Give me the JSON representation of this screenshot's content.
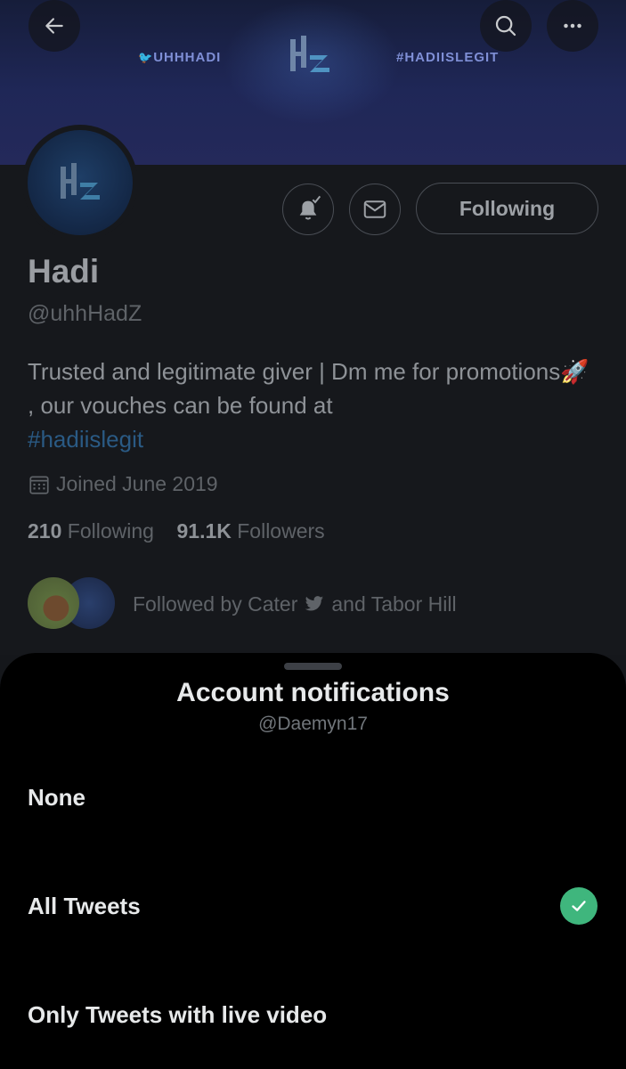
{
  "banner": {
    "left_text": "UHHHADI",
    "right_text": "#HADIISLEGIT"
  },
  "header": {
    "back_icon": "arrow-left-icon",
    "search_icon": "search-icon",
    "more_icon": "more-horizontal-icon"
  },
  "profile": {
    "name": "Hadi",
    "handle": "@uhhHadZ",
    "bio_text": "Trusted and legitimate giver | Dm me for promotions🚀 , our vouches can be found at",
    "bio_hashtag": "#hadiislegit",
    "joined": "Joined June 2019",
    "following_count": "210",
    "following_label": "Following",
    "followers_count": "91.1K",
    "followers_label": "Followers",
    "followed_by_prefix": "Followed by Cater",
    "followed_by_suffix": "and Tabor Hill",
    "following_button": "Following"
  },
  "sheet": {
    "title": "Account notifications",
    "subtitle": "@Daemyn17",
    "options": [
      {
        "label": "None",
        "selected": false
      },
      {
        "label": "All Tweets",
        "selected": true
      },
      {
        "label": "Only Tweets with live video",
        "selected": false
      }
    ]
  },
  "colors": {
    "check": "#3fb67d",
    "hashtag": "#1d9bf0"
  }
}
